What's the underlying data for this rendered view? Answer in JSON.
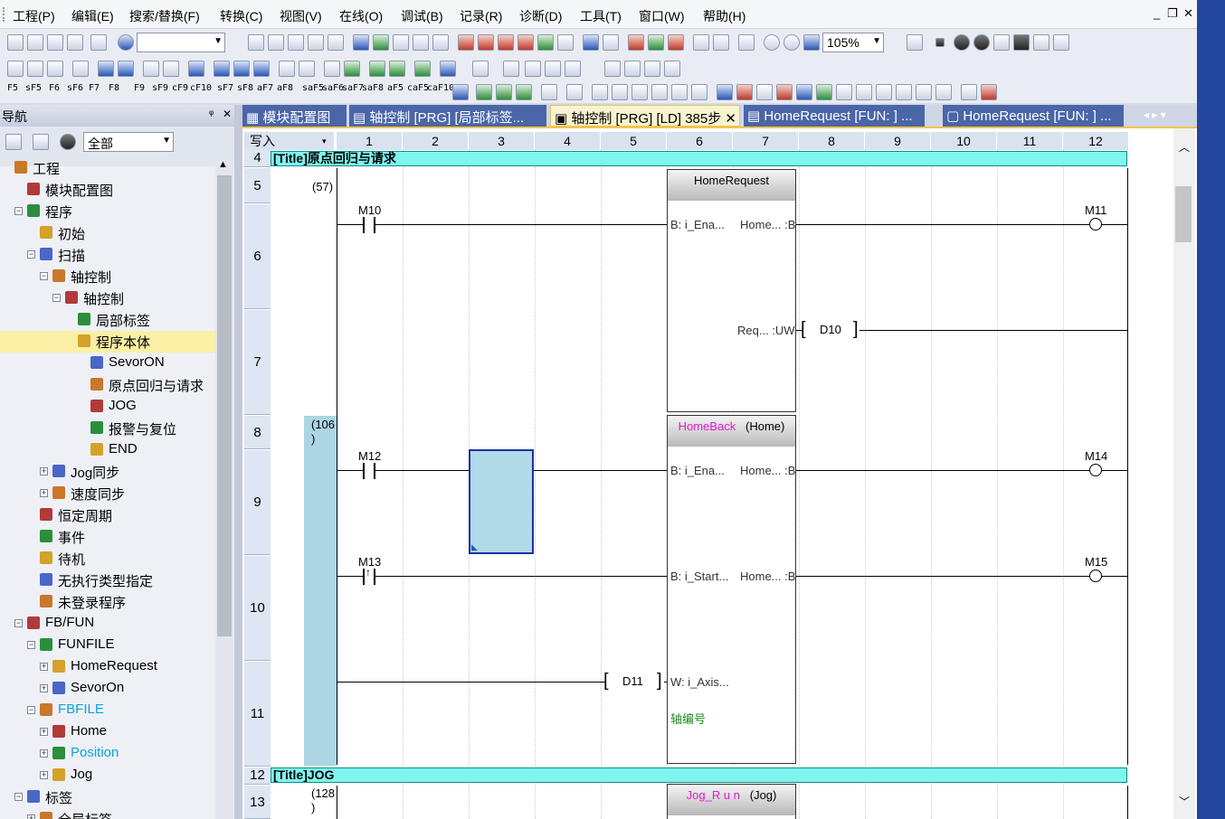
{
  "menu": [
    "工程(P)",
    "编辑(E)",
    "搜索/替换(F)",
    "转换(C)",
    "视图(V)",
    "在线(O)",
    "调试(B)",
    "记录(R)",
    "诊断(D)",
    "工具(T)",
    "窗口(W)",
    "帮助(H)"
  ],
  "window_controls": [
    "_",
    "❐",
    "✕"
  ],
  "toolbar": {
    "zoom": "105%",
    "combo_blank": ""
  },
  "fkeys": [
    "F5",
    "sF5",
    "F6",
    "sF6",
    "F7",
    "F8",
    "F9",
    "sF9",
    "cF9",
    "cF10",
    "sF7",
    "sF8",
    "aF7",
    "aF8",
    "saF5",
    "saF6",
    "saF7",
    "saF8",
    "aF5",
    "caF5",
    "caF10"
  ],
  "nav": {
    "title": "导航",
    "pin": "ᵠ",
    "close": "✕",
    "filter": "全部",
    "tree": [
      {
        "label": "工程",
        "exp": "",
        "indent": 0
      },
      {
        "label": "模块配置图",
        "exp": "",
        "indent": 1
      },
      {
        "label": "程序",
        "exp": "⊟",
        "indent": 1
      },
      {
        "label": "初始",
        "exp": "",
        "indent": 2
      },
      {
        "label": "扫描",
        "exp": "⊟",
        "indent": 2
      },
      {
        "label": "轴控制",
        "exp": "⊟",
        "indent": 3
      },
      {
        "label": "轴控制",
        "exp": "⊟",
        "indent": 4
      },
      {
        "label": "局部标签",
        "exp": "",
        "indent": 5
      },
      {
        "label": "程序本体",
        "exp": "",
        "indent": 5,
        "selected": true
      },
      {
        "label": "SevorON",
        "exp": "",
        "indent": 6
      },
      {
        "label": "原点回归与请求",
        "exp": "",
        "indent": 6
      },
      {
        "label": "JOG",
        "exp": "",
        "indent": 6
      },
      {
        "label": "报警与复位",
        "exp": "",
        "indent": 6
      },
      {
        "label": "END",
        "exp": "",
        "indent": 6
      },
      {
        "label": "Jog同步",
        "exp": "⊞",
        "indent": 3
      },
      {
        "label": "速度同步",
        "exp": "⊞",
        "indent": 3
      },
      {
        "label": "恒定周期",
        "exp": "",
        "indent": 2
      },
      {
        "label": "事件",
        "exp": "",
        "indent": 2
      },
      {
        "label": "待机",
        "exp": "",
        "indent": 2
      },
      {
        "label": "无执行类型指定",
        "exp": "",
        "indent": 2
      },
      {
        "label": "未登录程序",
        "exp": "",
        "indent": 2
      },
      {
        "label": "FB/FUN",
        "exp": "⊟",
        "indent": 1
      },
      {
        "label": "FUNFILE",
        "exp": "⊟",
        "indent": 2
      },
      {
        "label": "HomeRequest",
        "exp": "⊞",
        "indent": 3
      },
      {
        "label": "SevorOn",
        "exp": "⊞",
        "indent": 3
      },
      {
        "label": "FBFILE",
        "exp": "⊟",
        "indent": 2,
        "cyan": true
      },
      {
        "label": "Home",
        "exp": "⊞",
        "indent": 3
      },
      {
        "label": "Position",
        "exp": "⊞",
        "indent": 3,
        "cyan": true
      },
      {
        "label": "Jog",
        "exp": "⊞",
        "indent": 3
      },
      {
        "label": "标签",
        "exp": "⊟",
        "indent": 1
      },
      {
        "label": "全局标签",
        "exp": "⊞",
        "indent": 2
      }
    ]
  },
  "tabs": [
    {
      "label": "模块配置图",
      "state": "inactive"
    },
    {
      "label": "轴控制 [PRG] [局部标签...",
      "state": "inactive"
    },
    {
      "label": "轴控制 [PRG] [LD] 385步",
      "state": "active",
      "close": "✕"
    },
    {
      "label": "HomeRequest [FUN: ] ...",
      "state": "inactive"
    },
    {
      "label": "HomeRequest [FUN: ] ...",
      "state": "inactive"
    }
  ],
  "editor": {
    "mode": "写入",
    "columns": [
      "1",
      "2",
      "3",
      "4",
      "5",
      "6",
      "7",
      "8",
      "9",
      "10",
      "11",
      "12"
    ],
    "rows": [
      {
        "num": "4",
        "title": "[Title]原点回归与请求"
      },
      {
        "num": "5",
        "step": "(57)"
      },
      {
        "num": "6"
      },
      {
        "num": "7"
      },
      {
        "num": "8",
        "step": "(106\n)"
      },
      {
        "num": "9"
      },
      {
        "num": "10"
      },
      {
        "num": "11"
      },
      {
        "num": "12",
        "title": "[Title]JOG"
      },
      {
        "num": "13",
        "step": "(128\n)"
      }
    ],
    "block1": {
      "name": "HomeRequest",
      "in1": "B: i_Ena...",
      "out1": "Home... :B",
      "out2": "Req... :UW",
      "contact": "M10",
      "coil": "M11",
      "reg": "D10"
    },
    "block2": {
      "name": "HomeBack",
      "inst": "(Home)",
      "in1": "B: i_Ena...",
      "out1": "Home... :B",
      "in2": "B: i_Start...",
      "out2": "Home... :B",
      "in3": "W: i_Axis...",
      "comment": "轴编号",
      "c1": "M12",
      "coil1": "M14",
      "c2": "M13",
      "coil2": "M15",
      "reg": "D11"
    },
    "block3": {
      "name": "Jog_R u n",
      "inst": "(Jog)"
    }
  }
}
